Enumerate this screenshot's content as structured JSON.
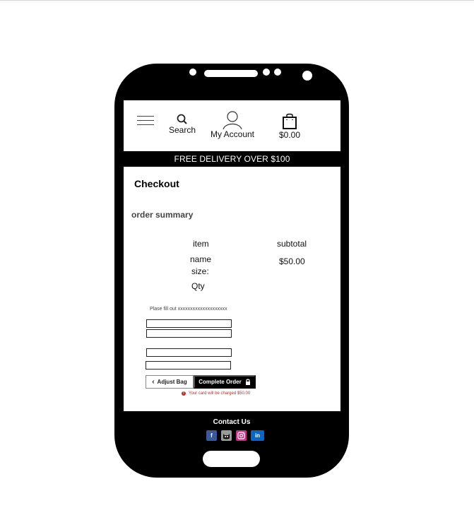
{
  "header": {
    "search_label": "Search",
    "account_label": "My Account",
    "bag_total": "$0.00"
  },
  "banner": {
    "text": "FREE DELIVERY OVER $100"
  },
  "checkout": {
    "title": "Checkout",
    "section_title": "order summary",
    "columns": {
      "item": "item",
      "subtotal": "subtotal"
    },
    "item": {
      "name": "name",
      "size": "size:",
      "qty": "Qty",
      "subtotal": "$50.00"
    },
    "form_hint": "Plase fill out xxxxxxxxxxxxxxxxxxxx",
    "adjust_button_label": "Adjust Bag",
    "complete_button_label": "Complete Order",
    "charge_note": "Your card will be charged $50.00"
  },
  "footer": {
    "title": "Contact Us",
    "social_icons": [
      "facebook-icon",
      "github-icon",
      "instagram-icon",
      "linkedin-icon"
    ]
  },
  "colors": {
    "phone": "#000000",
    "screen": "#ffffff",
    "alert": "#b3312d",
    "facebook": "#3b5998",
    "linkedin": "#0a66c2",
    "instagram": "#c13584"
  }
}
